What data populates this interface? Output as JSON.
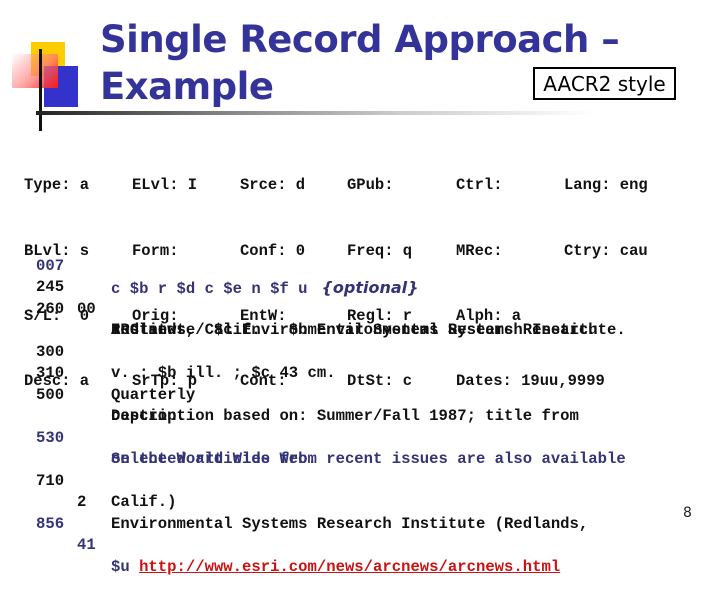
{
  "slide": {
    "title_line1": "Single Record Approach –",
    "title_line2": "Example",
    "style_label": "AACR2 style",
    "page_number": "8",
    "colors": {
      "title": "#333399",
      "logo_yellow": "#ffcc00",
      "logo_red": "#ff1a1a",
      "logo_blue": "#3333cc",
      "highlight_text": "#333377",
      "link": "#cc1111"
    }
  },
  "fixed_fields": {
    "col1": [
      "Type: a",
      "BLvl: s",
      "S/L:  0",
      "Desc: a"
    ],
    "col2": [
      "ELvl: I",
      "Form:",
      "Orig:",
      "SrTp: p"
    ],
    "col3": [
      "Srce: d",
      "Conf: 0",
      "EntW:",
      "Cont:"
    ],
    "col4": [
      "GPub:",
      "Freq: q",
      "Regl: r",
      "DtSt: c"
    ],
    "col5": [
      "Ctrl:",
      "MRec:",
      "Alph: a",
      "Dates: 19uu,9999"
    ],
    "col6": [
      "Lang: eng",
      "Ctry: cau",
      "",
      ""
    ]
  },
  "marc_fields": [
    {
      "tag": "007",
      "ind": "",
      "lines": [
        "c $b r $d c $e n $f u"
      ],
      "note": "{optional}",
      "highlight": true
    },
    {
      "tag": "245",
      "ind": "00",
      "lines": [
        "ARC news / $c Environmental Systems Research Institute."
      ],
      "highlight": false
    },
    {
      "tag": "260",
      "ind": "",
      "lines": [
        "Redlands, Calif. : $b Environmental Systems Research",
        "Institute"
      ],
      "highlight": false
    },
    {
      "tag": "300",
      "ind": "",
      "lines": [
        "v. : $b ill. ; $c 43 cm."
      ],
      "highlight": false
    },
    {
      "tag": "310",
      "ind": "",
      "lines": [
        "Quarterly"
      ],
      "highlight": false
    },
    {
      "tag": "500",
      "ind": "",
      "lines": [
        "Description based on: Summer/Fall 1987; title from",
        "caption."
      ],
      "highlight": false
    },
    {
      "tag": "530",
      "ind": "",
      "lines": [
        "Selected articles from recent issues are also available",
        "on the World Wide Web."
      ],
      "highlight": true
    },
    {
      "tag": "710",
      "ind": "2",
      "lines": [
        "Environmental Systems Research Institute (Redlands,",
        "Calif.)"
      ],
      "highlight": false
    },
    {
      "tag": "856",
      "ind": "41",
      "prefix": "$u ",
      "link": "http://www.esri.com/news/arcnews/arcnews.html",
      "highlight": true
    }
  ]
}
